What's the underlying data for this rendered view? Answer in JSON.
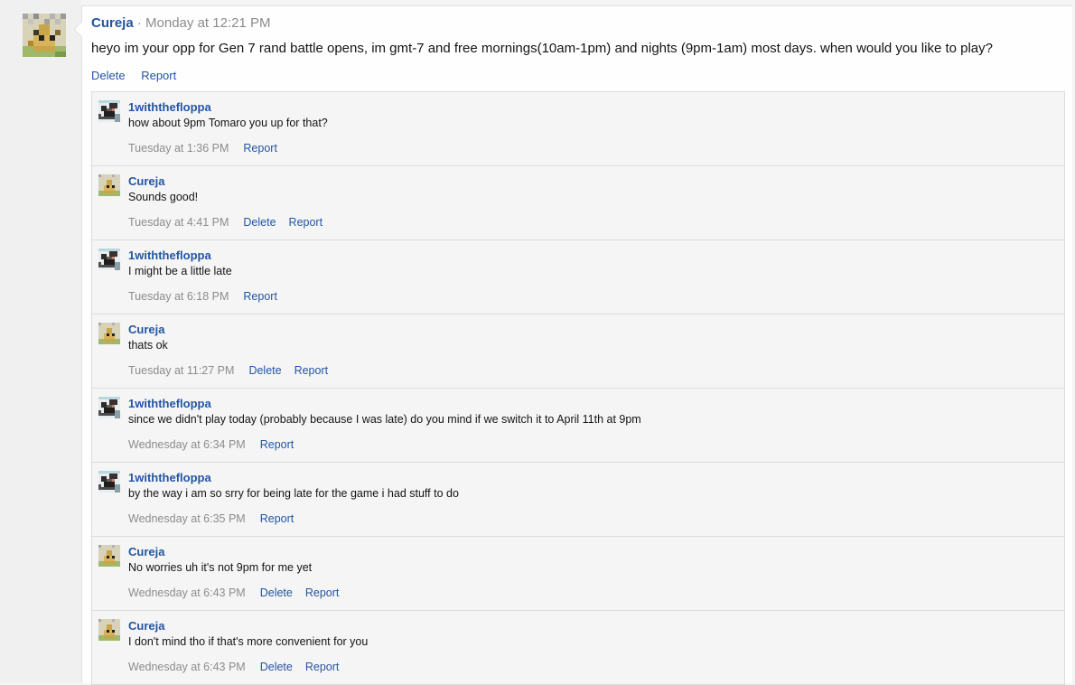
{
  "post": {
    "author": "Cureja",
    "separator": "·",
    "time": "Monday at 12:21 PM",
    "body": "heyo im your opp for Gen 7 rand battle opens, im gmt-7 and free mornings(10am-1pm) and nights (9pm-1am) most days. when would you like to play?",
    "actions": {
      "delete": "Delete",
      "report": "Report"
    }
  },
  "comments": [
    {
      "author": "1withthefloppa",
      "avatar": "floppa-avatar",
      "text": "how about 9pm Tomaro you up for that?",
      "time": "Tuesday at 1:36 PM",
      "delete": "",
      "report": "Report"
    },
    {
      "author": "Cureja",
      "avatar": "cureja-avatar",
      "text": "Sounds good!",
      "time": "Tuesday at 4:41 PM",
      "delete": "Delete",
      "report": "Report"
    },
    {
      "author": "1withthefloppa",
      "avatar": "floppa-avatar",
      "text": "I might be a little late",
      "time": "Tuesday at 6:18 PM",
      "delete": "",
      "report": "Report"
    },
    {
      "author": "Cureja",
      "avatar": "cureja-avatar",
      "text": "thats ok",
      "time": "Tuesday at 11:27 PM",
      "delete": "Delete",
      "report": "Report"
    },
    {
      "author": "1withthefloppa",
      "avatar": "floppa-avatar",
      "text": "since we didn't play today (probably because I was late) do you mind if we switch it to April 11th at 9pm",
      "time": "Wednesday at 6:34 PM",
      "delete": "",
      "report": "Report"
    },
    {
      "author": "1withthefloppa",
      "avatar": "floppa-avatar",
      "text": "by the way i am so srry for being late for the game i had stuff to do",
      "time": "Wednesday at 6:35 PM",
      "delete": "",
      "report": "Report"
    },
    {
      "author": "Cureja",
      "avatar": "cureja-avatar",
      "text": "No worries uh it's not 9pm for me yet",
      "time": "Wednesday at 6:43 PM",
      "delete": "Delete",
      "report": "Report"
    },
    {
      "author": "Cureja",
      "avatar": "cureja-avatar",
      "text": "I don't mind tho if that's more convenient for you",
      "time": "Wednesday at 6:43 PM",
      "delete": "Delete",
      "report": "Report"
    }
  ],
  "colors": {
    "link": "#2255a4",
    "muted": "#8c8c8c",
    "comment_bg": "#f5f5f5"
  }
}
